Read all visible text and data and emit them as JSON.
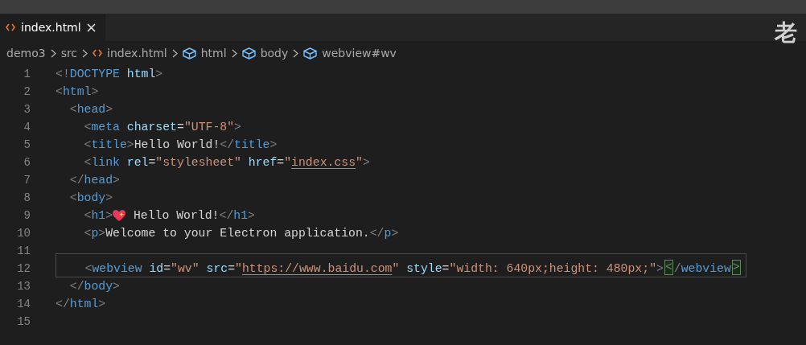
{
  "tabs": [
    {
      "label": "index.html",
      "selected": true
    }
  ],
  "watermark_text": "老",
  "breadcrumb": [
    {
      "label": "demo3",
      "kind": "folder"
    },
    {
      "label": "src",
      "kind": "folder"
    },
    {
      "label": "index.html",
      "kind": "file"
    },
    {
      "label": "html",
      "kind": "element"
    },
    {
      "label": "body",
      "kind": "element"
    },
    {
      "label": "webview#wv",
      "kind": "element"
    }
  ],
  "lines": [
    {
      "number": "1",
      "current": false,
      "tokens": [
        {
          "kind": "punct",
          "text": "<!"
        },
        {
          "kind": "tag",
          "text": "DOCTYPE"
        },
        {
          "kind": "attr",
          "text": " html"
        },
        {
          "kind": "punct",
          "text": ">"
        }
      ]
    },
    {
      "number": "2",
      "current": false,
      "tokens": [
        {
          "kind": "punct",
          "text": "<"
        },
        {
          "kind": "tag",
          "text": "html"
        },
        {
          "kind": "punct",
          "text": ">"
        }
      ]
    },
    {
      "number": "3",
      "current": false,
      "tokens": [
        {
          "kind": "punct",
          "text": "  <"
        },
        {
          "kind": "tag",
          "text": "head"
        },
        {
          "kind": "punct",
          "text": ">"
        }
      ]
    },
    {
      "number": "4",
      "current": false,
      "tokens": [
        {
          "kind": "punct",
          "text": "    <"
        },
        {
          "kind": "tag",
          "text": "meta"
        },
        {
          "kind": "attr",
          "text": " charset"
        },
        {
          "kind": "text",
          "text": "="
        },
        {
          "kind": "string",
          "text": "\"UTF-8\""
        },
        {
          "kind": "punct",
          "text": ">"
        }
      ]
    },
    {
      "number": "5",
      "current": false,
      "tokens": [
        {
          "kind": "punct",
          "text": "    <"
        },
        {
          "kind": "tag",
          "text": "title"
        },
        {
          "kind": "punct",
          "text": ">"
        },
        {
          "kind": "text",
          "text": "Hello World!"
        },
        {
          "kind": "punct",
          "text": "</"
        },
        {
          "kind": "tag",
          "text": "title"
        },
        {
          "kind": "punct",
          "text": ">"
        }
      ]
    },
    {
      "number": "6",
      "current": false,
      "tokens": [
        {
          "kind": "punct",
          "text": "    <"
        },
        {
          "kind": "tag",
          "text": "link"
        },
        {
          "kind": "attr",
          "text": " rel"
        },
        {
          "kind": "text",
          "text": "="
        },
        {
          "kind": "string",
          "text": "\"stylesheet\""
        },
        {
          "kind": "attr",
          "text": " href"
        },
        {
          "kind": "text",
          "text": "="
        },
        {
          "kind": "string",
          "text": "\""
        },
        {
          "kind": "string",
          "text": "index.css",
          "underlined": true
        },
        {
          "kind": "string",
          "text": "\""
        },
        {
          "kind": "punct",
          "text": ">"
        }
      ]
    },
    {
      "number": "7",
      "current": false,
      "tokens": [
        {
          "kind": "punct",
          "text": "  </"
        },
        {
          "kind": "tag",
          "text": "head"
        },
        {
          "kind": "punct",
          "text": ">"
        }
      ]
    },
    {
      "number": "8",
      "current": false,
      "tokens": [
        {
          "kind": "punct",
          "text": "  <"
        },
        {
          "kind": "tag",
          "text": "body"
        },
        {
          "kind": "punct",
          "text": ">"
        }
      ]
    },
    {
      "number": "9",
      "current": false,
      "tokens": [
        {
          "kind": "punct",
          "text": "    <"
        },
        {
          "kind": "tag",
          "text": "h1"
        },
        {
          "kind": "punct",
          "text": ">"
        },
        {
          "kind": "emoji"
        },
        {
          "kind": "text",
          "text": " Hello World!"
        },
        {
          "kind": "punct",
          "text": "</"
        },
        {
          "kind": "tag",
          "text": "h1"
        },
        {
          "kind": "punct",
          "text": ">"
        }
      ]
    },
    {
      "number": "10",
      "current": false,
      "tokens": [
        {
          "kind": "punct",
          "text": "    <"
        },
        {
          "kind": "tag",
          "text": "p"
        },
        {
          "kind": "punct",
          "text": ">"
        },
        {
          "kind": "text",
          "text": "Welcome to your Electron application."
        },
        {
          "kind": "punct",
          "text": "</"
        },
        {
          "kind": "tag",
          "text": "p"
        },
        {
          "kind": "punct",
          "text": ">"
        }
      ]
    },
    {
      "number": "11",
      "current": false
    },
    {
      "number": "12",
      "current": true,
      "tokens": [
        {
          "kind": "punct",
          "text": "    <"
        },
        {
          "kind": "tag",
          "text": "webview"
        },
        {
          "kind": "attr",
          "text": " id"
        },
        {
          "kind": "text",
          "text": "="
        },
        {
          "kind": "string",
          "text": "\"wv\""
        },
        {
          "kind": "attr",
          "text": " src"
        },
        {
          "kind": "text",
          "text": "="
        },
        {
          "kind": "string",
          "text": "\""
        },
        {
          "kind": "string",
          "text": "https://www.baidu.com",
          "underlined": true
        },
        {
          "kind": "string",
          "text": "\""
        },
        {
          "kind": "attr",
          "text": " style"
        },
        {
          "kind": "text",
          "text": "="
        },
        {
          "kind": "string",
          "text": "\"width: 640px;height: 480px;\""
        },
        {
          "kind": "punct",
          "text": ">"
        },
        {
          "kind": "punct",
          "text": "<",
          "matched": true
        },
        {
          "kind": "punct",
          "text": "/"
        },
        {
          "kind": "tag",
          "text": "webview"
        },
        {
          "kind": "punct",
          "text": ">",
          "matched": true
        }
      ]
    },
    {
      "number": "13",
      "current": false,
      "tokens": [
        {
          "kind": "punct",
          "text": "  </"
        },
        {
          "kind": "tag",
          "text": "body"
        },
        {
          "kind": "punct",
          "text": ">"
        }
      ]
    },
    {
      "number": "14",
      "current": false,
      "tokens": [
        {
          "kind": "punct",
          "text": "</"
        },
        {
          "kind": "tag",
          "text": "html"
        },
        {
          "kind": "punct",
          "text": ">"
        }
      ]
    },
    {
      "number": "15",
      "current": false
    }
  ]
}
